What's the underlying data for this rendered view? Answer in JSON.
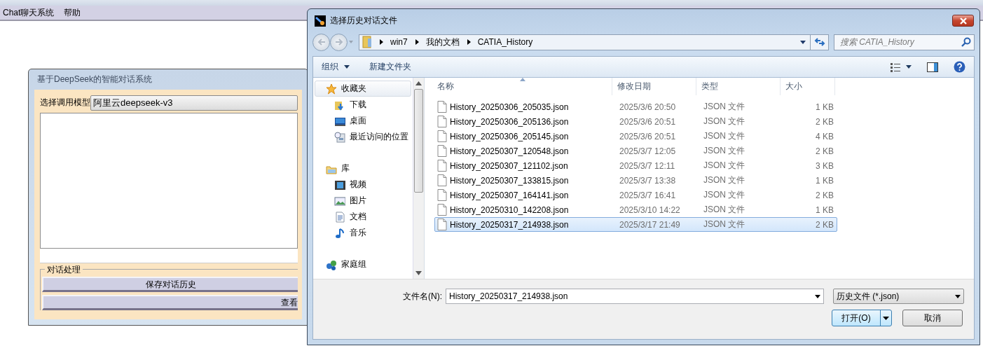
{
  "menu_bar": {
    "items": [
      "Chat聊天系统",
      "帮助"
    ]
  },
  "app_window": {
    "title": "基于DeepSeek的智能对话系统",
    "model_label": "选择调用模型",
    "model_value": "阿里云deepseek-v3",
    "group_title": "对话处理",
    "buttons": [
      "保存对话历史",
      "查看"
    ]
  },
  "dialog": {
    "title": "选择历史对话文件",
    "breadcrumb": [
      "win7",
      "我的文档",
      "CATIA_History"
    ],
    "search": {
      "placeholder": "搜索 CATIA_History"
    },
    "toolbar": [
      "组织",
      "新建文件夹"
    ],
    "nav": [
      {
        "label": "收藏夹",
        "selected": true,
        "children": [
          {
            "label": "下载",
            "selected": false
          },
          {
            "label": "桌面",
            "selected": false
          },
          {
            "label": "最近访问的位置",
            "selected": false
          }
        ]
      },
      {
        "label": "库",
        "selected": false,
        "children": [
          {
            "label": "视频",
            "selected": false
          },
          {
            "label": "图片",
            "selected": false
          },
          {
            "label": "文档",
            "selected": false
          },
          {
            "label": "音乐",
            "selected": false
          }
        ]
      },
      {
        "label": "家庭组",
        "selected": false
      }
    ],
    "columns": [
      "名称",
      "修改日期",
      "类型",
      "大小"
    ],
    "files": [
      {
        "name": "History_20250306_205035.json",
        "modified": "2025/3/6 20:50",
        "type": "JSON 文件",
        "size": "1 KB",
        "selected": false
      },
      {
        "name": "History_20250306_205136.json",
        "modified": "2025/3/6 20:51",
        "type": "JSON 文件",
        "size": "2 KB",
        "selected": false
      },
      {
        "name": "History_20250306_205145.json",
        "modified": "2025/3/6 20:51",
        "type": "JSON 文件",
        "size": "4 KB",
        "selected": false
      },
      {
        "name": "History_20250307_120548.json",
        "modified": "2025/3/7 12:05",
        "type": "JSON 文件",
        "size": "2 KB",
        "selected": false
      },
      {
        "name": "History_20250307_121102.json",
        "modified": "2025/3/7 12:11",
        "type": "JSON 文件",
        "size": "3 KB",
        "selected": false
      },
      {
        "name": "History_20250307_133815.json",
        "modified": "2025/3/7 13:38",
        "type": "JSON 文件",
        "size": "1 KB",
        "selected": false
      },
      {
        "name": "History_20250307_164141.json",
        "modified": "2025/3/7 16:41",
        "type": "JSON 文件",
        "size": "2 KB",
        "selected": false
      },
      {
        "name": "History_20250310_142208.json",
        "modified": "2025/3/10 14:22",
        "type": "JSON 文件",
        "size": "1 KB",
        "selected": false
      },
      {
        "name": "History_20250317_214938.json",
        "modified": "2025/3/17 21:49",
        "type": "JSON 文件",
        "size": "2 KB",
        "selected": true
      }
    ],
    "filename_label": "文件名(N):",
    "filename": "History_20250317_214938.json",
    "filter": "历史文件 (*.json)",
    "open_button": "打开(O)",
    "cancel_button": "取消"
  }
}
